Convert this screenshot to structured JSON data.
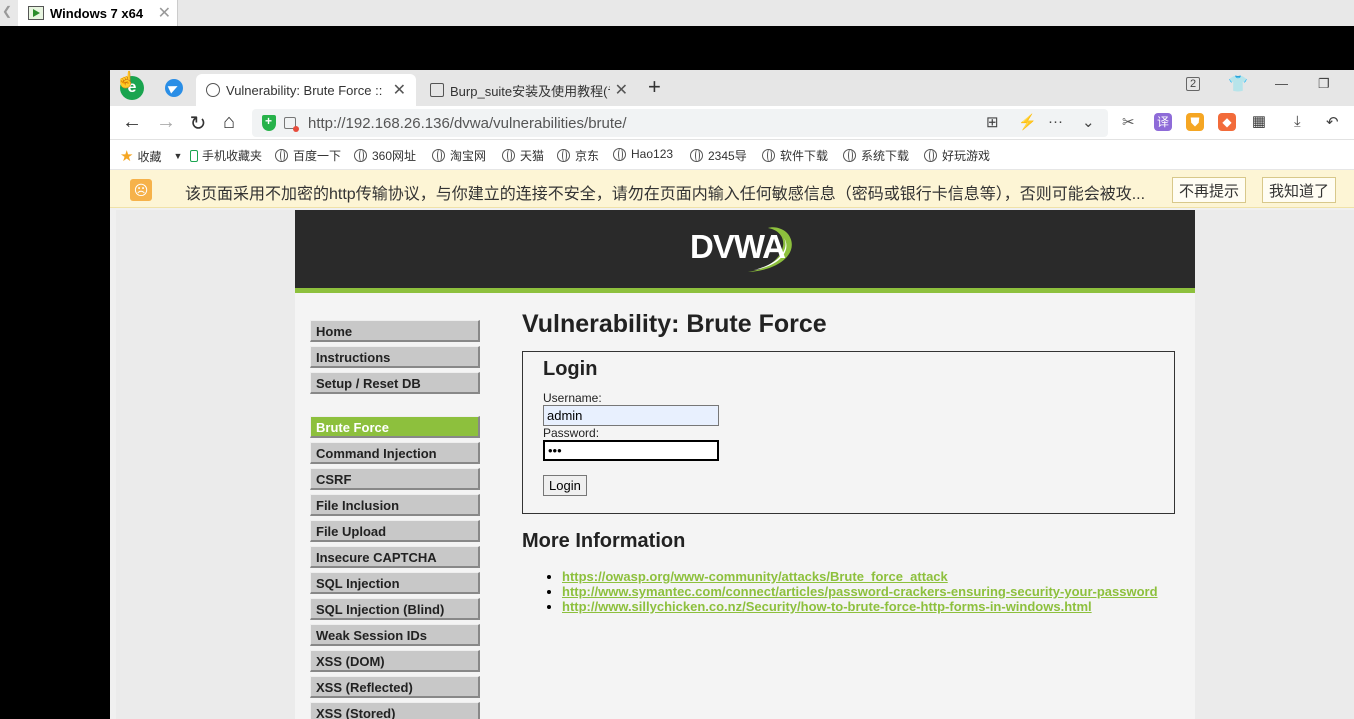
{
  "host": {
    "tab_title": "Windows 7 x64",
    "tab_close": "✕"
  },
  "browser": {
    "logo_letter": "e",
    "tabs": [
      {
        "title": "Vulnerability: Brute Force :: ",
        "close": "✕"
      },
      {
        "title": "Burp_suite安装及使用教程(专",
        "close": "✕"
      }
    ],
    "new_tab": "+",
    "tab_count": "2",
    "url": "http://192.168.26.136/dvwa/vulnerabilities/brute/",
    "bookmarks": [
      {
        "label": "收藏",
        "icon": "star-icon"
      },
      {
        "label": "手机收藏夹",
        "icon": "phone-icon"
      },
      {
        "label": "百度一下",
        "icon": "globe-icon"
      },
      {
        "label": "360网址",
        "icon": "globe-icon"
      },
      {
        "label": "淘宝网",
        "icon": "globe-icon"
      },
      {
        "label": "天猫",
        "icon": "globe-icon"
      },
      {
        "label": "京东",
        "icon": "globe-icon"
      },
      {
        "label": "Hao123",
        "icon": "globe-icon"
      },
      {
        "label": "2345导",
        "icon": "globe-icon"
      },
      {
        "label": "软件下载",
        "icon": "globe-icon"
      },
      {
        "label": "系统下载",
        "icon": "globe-icon"
      },
      {
        "label": "好玩游戏",
        "icon": "globe-icon"
      }
    ],
    "warning": {
      "text": "该页面采用不加密的http传输协议，与你建立的连接不安全，请勿在页面内输入任何敏感信息（密码或银行卡信息等），否则可能会被攻...",
      "dismiss_label": "不再提示",
      "ok_label": "我知道了"
    }
  },
  "dvwa": {
    "logo": "DVWA",
    "menu": {
      "group1": [
        "Home",
        "Instructions",
        "Setup / Reset DB"
      ],
      "group2": [
        "Brute Force",
        "Command Injection",
        "CSRF",
        "File Inclusion",
        "File Upload",
        "Insecure CAPTCHA",
        "SQL Injection",
        "SQL Injection (Blind)",
        "Weak Session IDs",
        "XSS (DOM)",
        "XSS (Reflected)",
        "XSS (Stored)"
      ],
      "selected": "Brute Force"
    },
    "page_title": "Vulnerability: Brute Force",
    "login": {
      "heading": "Login",
      "username_label": "Username:",
      "username_value": "admin",
      "password_label": "Password:",
      "password_value": "•••",
      "button_label": "Login"
    },
    "more_info": {
      "heading": "More Information",
      "links": [
        "https://owasp.org/www-community/attacks/Brute_force_attack",
        "http://www.symantec.com/connect/articles/password-crackers-ensuring-security-your-password",
        "http://www.sillychicken.co.nz/Security/how-to-brute-force-http-forms-in-windows.html"
      ]
    }
  },
  "colors": {
    "accent": "#8dc03d",
    "header_bg": "#2a2a2a",
    "warning_bg": "#fdf5d5"
  }
}
